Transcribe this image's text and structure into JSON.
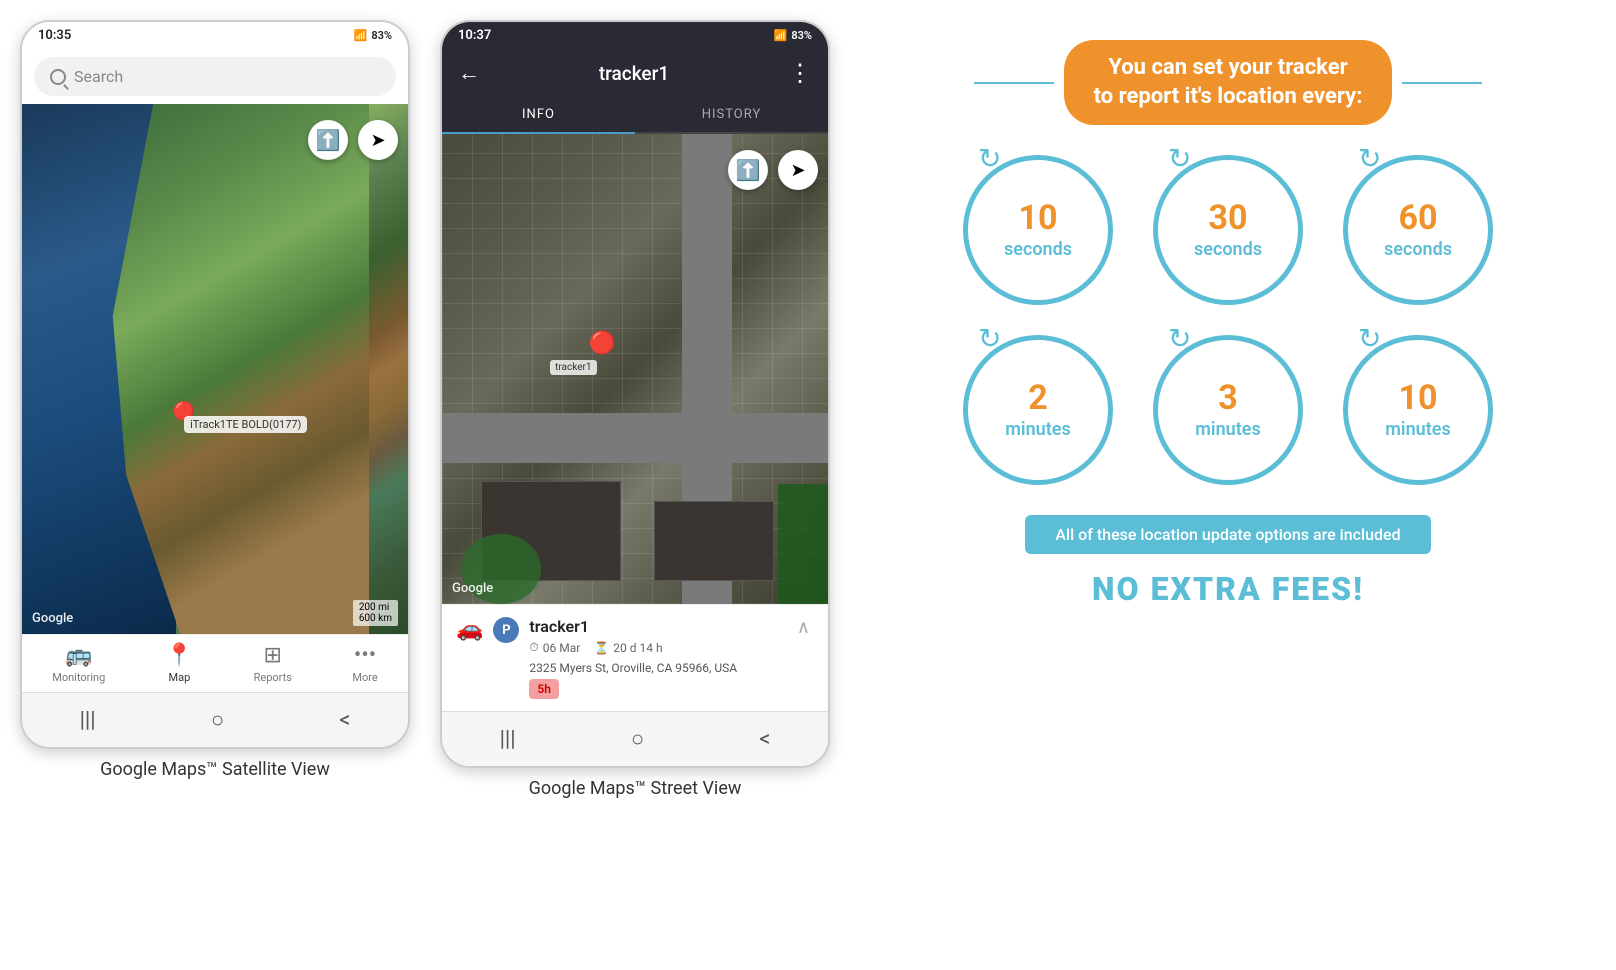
{
  "phones": {
    "phone1": {
      "status_time": "10:35",
      "status_signal": "📶",
      "status_battery": "83%",
      "search_placeholder": "Search",
      "map_watermark": "Google",
      "map_scale": "200 mi\n600 km",
      "tracker_label": "iTrack1TE BOLD(0177)",
      "compass_icon": "⬆",
      "nav_icon": "➤",
      "nav_items": [
        {
          "label": "Monitoring",
          "icon": "🚌",
          "active": false
        },
        {
          "label": "Map",
          "icon": "📍",
          "active": true
        },
        {
          "label": "Reports",
          "icon": "⊞",
          "active": false
        },
        {
          "label": "More",
          "icon": "•••",
          "active": false
        }
      ],
      "bottom_buttons": [
        "|||",
        "○",
        "<"
      ]
    },
    "phone2": {
      "status_time": "10:37",
      "status_signal": "📶",
      "status_battery": "83%",
      "header_title": "tracker1",
      "back_arrow": "←",
      "more_icon": "⋮",
      "tabs": [
        {
          "label": "INFO",
          "active": true
        },
        {
          "label": "HISTORY",
          "active": false
        }
      ],
      "aerial_label": "tracker1",
      "google_watermark": "Google",
      "tracker_name": "tracker1",
      "tracker_date": "06 Mar",
      "tracker_duration": "20 d 14 h",
      "tracker_address": "2325 Myers St, Oroville, CA 95966, USA",
      "tracker_5h": "5h",
      "bottom_buttons": [
        "|||",
        "○",
        "<"
      ]
    }
  },
  "infographic": {
    "title_line1": "You can set your tracker",
    "title_line2": "to report it's location every:",
    "intervals": [
      {
        "number": "10",
        "unit": "seconds"
      },
      {
        "number": "30",
        "unit": "seconds"
      },
      {
        "number": "60",
        "unit": "seconds"
      },
      {
        "number": "2",
        "unit": "minutes"
      },
      {
        "number": "3",
        "unit": "minutes"
      },
      {
        "number": "10",
        "unit": "minutes"
      }
    ],
    "no_fees_label": "All of these location update options are included",
    "no_fees_cta": "NO EXTRA FEES!",
    "colors": {
      "orange": "#f0922b",
      "blue": "#5bbdd6"
    }
  },
  "captions": {
    "phone1_caption": "Google Maps™ Satellite View",
    "phone2_caption": "Google Maps™ Street View"
  }
}
